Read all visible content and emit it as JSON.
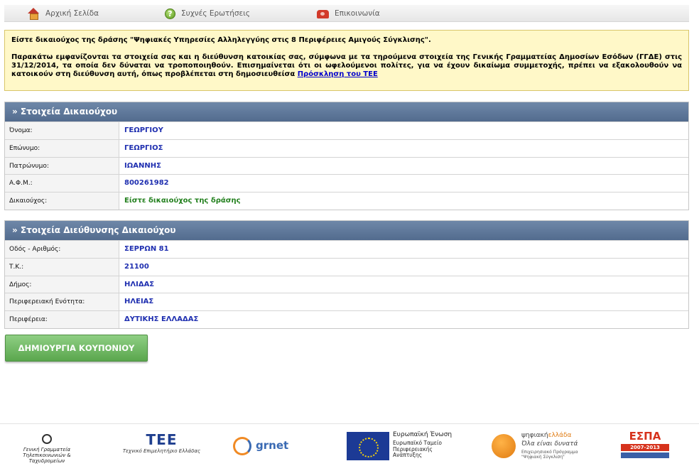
{
  "nav": {
    "home": "Αρχική Σελίδα",
    "faq": "Συχνές Ερωτήσεις",
    "contact": "Επικοινωνία"
  },
  "info": {
    "line1": "Είστε δικαιούχος της δράσης \"Ψηφιακές Υπηρεσίες Αλληλεγγύης στις 8 Περιφέρειες Αμιγούς Σύγκλισης\".",
    "line2": "Παρακάτω εμφανίζονται τα στοιχεία σας και η διεύθυνση κατοικίας σας, σύμφωνα με τα τηρούμενα στοιχεία της Γενικής Γραμματείας Δημοσίων Εσόδων (ΓΓΔΕ) στις 31/12/2014, τα οποία δεν δύναται να τροποποιηθούν. Επισημαίνεται ότι οι ωφελούμενοι πολίτες, για να έχουν δικαίωμα συμμετοχής, πρέπει να εξακολουθούν να κατοικούν στη διεύθυνση αυτή, όπως προβλέπεται στη δημοσιευθείσα",
    "link": "Πρόσκληση του ΤΕΕ"
  },
  "beneficiary": {
    "title": "» Στοιχεία Δικαιούχου",
    "rows": [
      {
        "label": "Όνομα:",
        "value": "ΓΕΩΡΓΙΟΥ"
      },
      {
        "label": "Επώνυμο:",
        "value": "ΓΕΩΡΓΙΟΣ"
      },
      {
        "label": "Πατρώνυμο:",
        "value": "ΙΩΑΝΝΗΣ"
      },
      {
        "label": "Α.Φ.Μ.:",
        "value": "800261982"
      },
      {
        "label": "Δικαιούχος:",
        "value": "Είστε δικαιούχος της δράσης"
      }
    ]
  },
  "address": {
    "title": "» Στοιχεία Διεύθυνσης Δικαιούχου",
    "rows": [
      {
        "label": "Οδός - Αριθμός:",
        "value": "ΣΕΡΡΩΝ 81"
      },
      {
        "label": "Τ.Κ.:",
        "value": "21100"
      },
      {
        "label": "Δήμος:",
        "value": "ΗΛΙΔΑΣ"
      },
      {
        "label": "Περιφερειακή Ενότητα:",
        "value": "ΗΛΕΙΑΣ"
      },
      {
        "label": "Περιφέρεια:",
        "value": "ΔΥΤΙΚΗΣ ΕΛΛΑΔΑΣ"
      }
    ]
  },
  "button": {
    "create_coupon": "ΔΗΜΙΟΥΡΓΙΑ ΚΟΥΠΟΝΙΟΥ"
  },
  "footer": {
    "gg_line1": "Γενική Γραμματεία",
    "gg_line2": "Τηλεπικοινωνιών & Ταχυδρομείων",
    "tee_big": "ΤΕΕ",
    "tee_small": "Τεχνικό Επιμελητήριο Ελλάδας",
    "grnet": "grnet",
    "eu_title": "Ευρωπαϊκή Ένωση",
    "eu_line1": "Ευρωπαϊκό Ταμείο",
    "eu_line2": "Περιφερειακής",
    "eu_line3": "Ανάπτυξης",
    "psif_a": "ψηφιακή",
    "psif_b": "ελλάδα",
    "psif_motto": "Όλα είναι δυνατά",
    "psif_sub1": "Επιχειρησιακό Πρόγραμμα",
    "psif_sub2": "\"Ψηφιακή Σύγκλιση\"",
    "espa": "ΕΣΠΑ",
    "espa_years": "2007-2013"
  },
  "colors": {
    "section_header": "#5f789b",
    "value_blue": "#1f2fb0",
    "value_green": "#23801e",
    "info_bg": "#fff8c8",
    "button_green": "#6cb45e"
  }
}
